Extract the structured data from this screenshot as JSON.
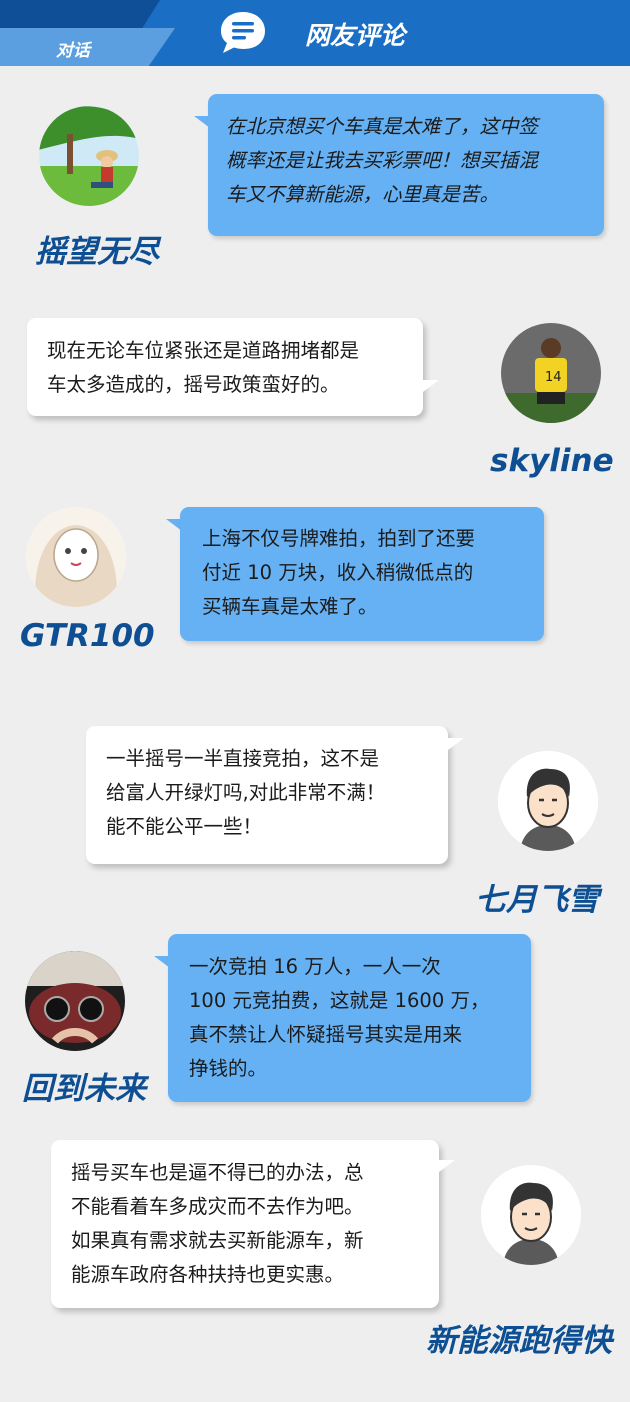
{
  "header": {
    "tab_label": "对话",
    "title": "网友评论",
    "icon": "chat-bubble-icon",
    "colors": {
      "bar": "#1a6fc4",
      "dark": "#0f4f98",
      "tab": "#5c9fe0"
    }
  },
  "comments": [
    {
      "user": "摇望无尽",
      "avatar": "anime-character-under-tree-avatar",
      "bubble_color": "#65b1f3",
      "lines": [
        "在北京想买个车真是太难了，这中签",
        "概率还是让我去买彩票吧！想买插混",
        "车又不算新能源，心里真是苦。"
      ]
    },
    {
      "user": "skyline",
      "avatar": "footballer-number-14-avatar",
      "bubble_color": "#ffffff",
      "lines": [
        "现在无论车位紧张还是道路拥堵都是",
        "车太多造成的，摇号政策蛮好的。"
      ]
    },
    {
      "user": "GTR100",
      "avatar": "masked-anime-girl-avatar",
      "bubble_color": "#65b1f3",
      "lines": [
        "上海不仅号牌难拍，拍到了还要",
        "付近 10 万块，收入稍微低点的",
        "买辆车真是太难了。"
      ]
    },
    {
      "user": "七月飞雪",
      "avatar": "cartoon-man-avatar",
      "bubble_color": "#ffffff",
      "lines": [
        "一半摇号一半直接竞拍，这不是",
        "给富人开绿灯吗,对此非常不满！",
        "能不能公平一些！"
      ]
    },
    {
      "user": "回到未来",
      "avatar": "car-dashboard-avatar",
      "bubble_color": "#65b1f3",
      "lines": [
        "一次竞拍 16 万人，一人一次",
        "100 元竞拍费，这就是 1600 万，",
        "真不禁让人怀疑摇号其实是用来",
        "挣钱的。"
      ]
    },
    {
      "user": "新能源跑得快",
      "avatar": "cartoon-man-avatar",
      "bubble_color": "#ffffff",
      "lines": [
        "摇号买车也是逼不得已的办法，总",
        "不能看着车多成灾而不去作为吧。",
        "如果真有需求就去买新能源车，新",
        "能源车政府各种扶持也更实惠。"
      ]
    }
  ]
}
